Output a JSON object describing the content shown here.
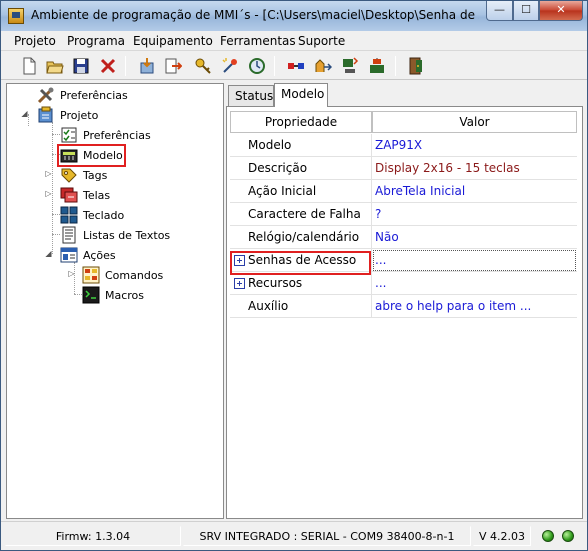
{
  "window": {
    "title": "Ambiente de programação de MMI´s - [C:\\Users\\maciel\\Desktop\\Senha de Acesso..."
  },
  "title_buttons": {
    "minimize": "—",
    "maximize": "☐",
    "close": "✕"
  },
  "menu": [
    "Projeto",
    "Programa",
    "Equipamento",
    "Ferramentas",
    "Suporte"
  ],
  "toolbar_icons": [
    "new-file-icon",
    "open-folder-icon",
    "save-icon",
    "delete-icon",
    "import-icon",
    "export-icon",
    "key-icon",
    "compile-icon",
    "refresh-icon",
    "connect-icon",
    "transfer-icon",
    "download-icon",
    "upload-icon",
    "exit-icon"
  ],
  "tree": {
    "items": [
      {
        "label": "Preferências",
        "icon": "tools-icon"
      },
      {
        "label": "Projeto",
        "icon": "project-icon"
      },
      {
        "label": "Preferências",
        "icon": "checklist-icon"
      },
      {
        "label": "Modelo",
        "icon": "device-icon"
      },
      {
        "label": "Tags",
        "icon": "tags-icon"
      },
      {
        "label": "Telas",
        "icon": "screens-icon"
      },
      {
        "label": "Teclado",
        "icon": "keyboard-icon"
      },
      {
        "label": "Listas de Textos",
        "icon": "text-list-icon"
      },
      {
        "label": "Ações",
        "icon": "actions-icon"
      },
      {
        "label": "Comandos",
        "icon": "commands-icon"
      },
      {
        "label": "Macros",
        "icon": "macros-icon"
      }
    ]
  },
  "tabs": [
    {
      "label": "Status"
    },
    {
      "label": "Modelo"
    }
  ],
  "grid": {
    "headers": {
      "property": "Propriedade",
      "value": "Valor"
    },
    "rows": [
      {
        "property": "Modelo",
        "value": "ZAP91X",
        "value_color": "#1a1ad6"
      },
      {
        "property": "Descrição",
        "value": "Display 2x16 - 15 teclas",
        "value_color": "#8b1a1a"
      },
      {
        "property": "Ação Inicial",
        "value": "AbreTela Inicial",
        "value_color": "#1a1ad6"
      },
      {
        "property": "Caractere de Falha",
        "value": "?",
        "value_color": "#1a1ad6"
      },
      {
        "property": "Relógio/calendário",
        "value": "Não",
        "value_color": "#1a1ad6"
      },
      {
        "property": "Senhas de Acesso",
        "value": "...",
        "value_color": "#1a1ad6",
        "expandable": true
      },
      {
        "property": "Recursos",
        "value": "...",
        "value_color": "#1a1ad6",
        "expandable": true
      },
      {
        "property": "Auxílio",
        "value": "abre o help para o item ...",
        "value_color": "#1a1ad6"
      }
    ]
  },
  "status": {
    "firmware": "Firmw: 1.3.04",
    "connection": "SRV INTEGRADO : SERIAL - COM9 38400-8-n-1",
    "version": "V 4.2.03"
  },
  "colors": {
    "highlight": "#e02020",
    "value_blue": "#1a1ad6",
    "value_red": "#8b1a1a",
    "led_green": "#2e9a1a"
  }
}
